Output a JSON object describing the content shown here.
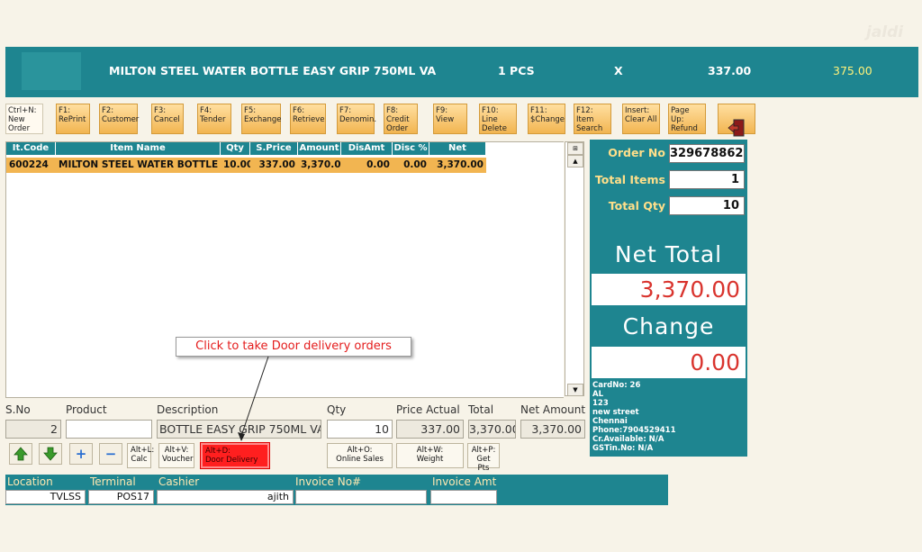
{
  "banner": {
    "item_name": "MILTON STEEL WATER BOTTLE  EASY GRIP 750ML VA",
    "qty": "1 PCS",
    "multiply": "X",
    "price": "337.00",
    "total": "375.00"
  },
  "logo": "jaldi",
  "function_keys": [
    {
      "label": "Ctrl+N:\nNew\nOrder"
    },
    {
      "label": "F1:\nRePrint"
    },
    {
      "label": "F2:\nCustomer"
    },
    {
      "label": "F3:\nCancel"
    },
    {
      "label": "F4:\nTender"
    },
    {
      "label": "F5:\nExchange"
    },
    {
      "label": "F6:\nRetrieve"
    },
    {
      "label": "F7:\nDenomin."
    },
    {
      "label": "F8:\nCredit\nOrder"
    },
    {
      "label": "F9:\nView"
    },
    {
      "label": "F10:\nLine\nDelete"
    },
    {
      "label": "F11:\n$Change"
    },
    {
      "label": "F12:\nItem\nSearch"
    },
    {
      "label": "Insert:\nClear All"
    },
    {
      "label": "Page Up:\nRefund"
    }
  ],
  "grid": {
    "headers": [
      "It.Code",
      "Item Name",
      "Qty",
      "S.Price",
      "Amount",
      "DisAmt",
      "Disc %",
      "Net Amount"
    ],
    "rows": [
      [
        "600224",
        "MILTON STEEL WATER BOTTLE ...",
        "10.00",
        "337.00",
        "3,370.00",
        "0.00",
        "0.00",
        "3,370.00"
      ]
    ]
  },
  "order": {
    "order_no_label": "Order No",
    "order_no": "329678862",
    "total_items_label": "Total Items",
    "total_items": "1",
    "total_qty_label": "Total Qty",
    "total_qty": "10",
    "net_total_label": "Net Total",
    "net_total": "3,370.00",
    "change_label": "Change",
    "change": "0.00"
  },
  "customer": {
    "card": "CardNo: 26",
    "name": "AL",
    "line1": "123",
    "line2": "new street",
    "city": "Chennai",
    "phone": "Phone:7904529411",
    "credit": "Cr.Available: N/A",
    "gstin": "GSTin.No: N/A"
  },
  "entry": {
    "labels": {
      "sno": "S.No",
      "product": "Product",
      "description": "Description",
      "qty": "Qty",
      "price_actual": "Price Actual",
      "total": "Total",
      "net_amount": "Net Amount"
    },
    "sno": "2",
    "product": "",
    "description": "BOTTLE  EASY GRIP 750ML VA",
    "qty": "10",
    "price_actual": "337.00",
    "total": "3,370.00",
    "net_amount": "3,370.00"
  },
  "buttons": {
    "calc": "Alt+L:\nCalc",
    "voucher": "Alt+V:\nVoucher",
    "door_delivery": "Alt+D:\nDoor Delivery",
    "online_sales": "Alt+O:\nOnline Sales",
    "weight": "Alt+W:\nWeight",
    "get_pts": "Alt+P:\nGet Pts",
    "plus": "+",
    "minus": "−"
  },
  "footer": {
    "location_label": "Location",
    "location": "TVLSS",
    "terminal_label": "Terminal",
    "terminal": "POS17",
    "cashier_label": "Cashier",
    "cashier": "ajith",
    "invoice_label": "Invoice No#",
    "invoice": "",
    "invoice_amt_label": "Invoice Amt",
    "invoice_amt": ""
  },
  "callout": "Click to take Door delivery orders",
  "colors": {
    "teal": "#1e8590",
    "orange": "#f2b551",
    "red": "#ff1f1f",
    "yellow": "#fff27a"
  }
}
